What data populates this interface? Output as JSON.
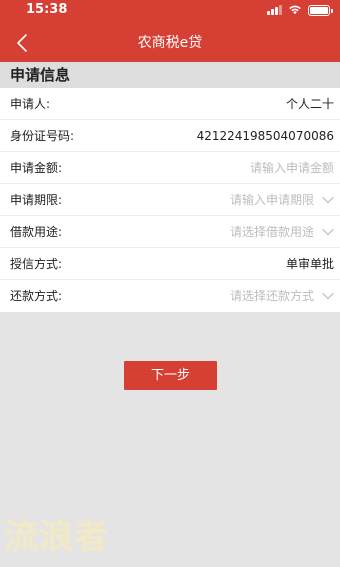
{
  "status_bar": {
    "time": "15:38"
  },
  "nav": {
    "title": "农商税e贷",
    "back_icon": "chevron-left-icon"
  },
  "colors": {
    "accent": "#d63f33",
    "background": "#e4e4e4",
    "placeholder": "#bdbdbd"
  },
  "section": {
    "title": "申请信息"
  },
  "form": {
    "applicant": {
      "label": "申请人:",
      "value": "个人二十"
    },
    "id_number": {
      "label": "身份证号码:",
      "value": "421224198504070086"
    },
    "amount": {
      "label": "申请金额:",
      "placeholder": "请输入申请金额"
    },
    "term": {
      "label": "申请期限:",
      "placeholder": "请输入申请期限"
    },
    "purpose": {
      "label": "借款用途:",
      "placeholder": "请选择借款用途"
    },
    "credit_method": {
      "label": "授信方式:",
      "value": "单审单批"
    },
    "repayment": {
      "label": "还款方式:",
      "placeholder": "请选择还款方式"
    }
  },
  "actions": {
    "next_label": "下一步"
  },
  "watermark": {
    "text": "流浪者"
  }
}
